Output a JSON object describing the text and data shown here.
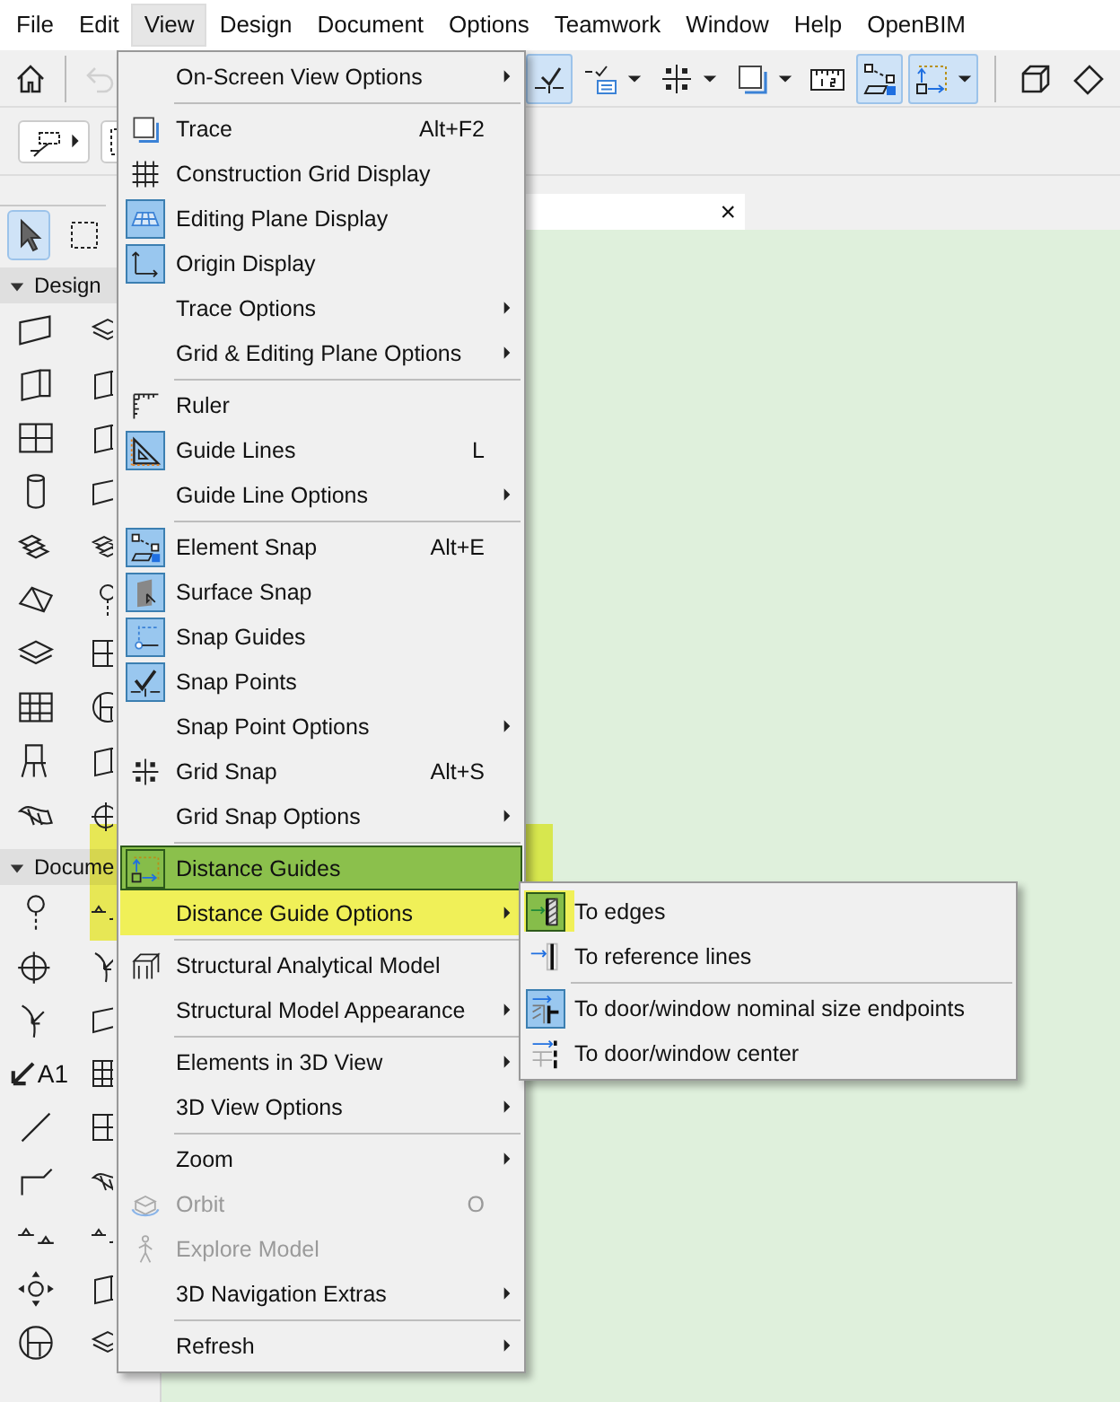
{
  "menubar": [
    {
      "label": "File",
      "open": false
    },
    {
      "label": "Edit",
      "open": false
    },
    {
      "label": "View",
      "open": true
    },
    {
      "label": "Design",
      "open": false
    },
    {
      "label": "Document",
      "open": false
    },
    {
      "label": "Options",
      "open": false
    },
    {
      "label": "Teamwork",
      "open": false
    },
    {
      "label": "Window",
      "open": false
    },
    {
      "label": "Help",
      "open": false
    },
    {
      "label": "OpenBIM",
      "open": false
    }
  ],
  "toolbar": {
    "left_buttons": [
      {
        "on": false,
        "disabled": false
      },
      {
        "on": false,
        "disabled": true
      }
    ],
    "right_buttons": [
      {
        "on": true,
        "dropdown": false
      },
      {
        "on": false,
        "dropdown": true
      },
      {
        "on": false,
        "dropdown": true
      },
      {
        "on": false,
        "dropdown": true
      },
      {
        "on": false,
        "dropdown": false
      },
      {
        "on": true,
        "dropdown": false
      },
      {
        "on": true,
        "dropdown": true
      },
      {
        "on": false,
        "dropdown": false
      },
      {
        "on": false,
        "dropdown": false
      }
    ]
  },
  "tab": {
    "close": "×"
  },
  "toolbox": {
    "tools": [
      {
        "selected": true
      },
      {
        "selected": false
      }
    ],
    "sections": [
      {
        "title": "Design",
        "expanded": true
      },
      {
        "title": "Docume",
        "expanded": true
      }
    ],
    "label_tool_text": "A1"
  },
  "view_menu": {
    "items": [
      {
        "kind": "item",
        "label": "On-Screen View Options",
        "submenu": true,
        "disabled": false,
        "highlighted": false
      },
      {
        "kind": "separator"
      },
      {
        "kind": "item",
        "label": "Trace",
        "shortcut": "Alt+F2",
        "checked": false,
        "submenu": false,
        "disabled": false,
        "highlighted": false
      },
      {
        "kind": "item",
        "label": "Construction Grid Display",
        "checked": false,
        "submenu": false,
        "disabled": false,
        "highlighted": false
      },
      {
        "kind": "item",
        "label": "Editing Plane Display",
        "checked": true,
        "submenu": false,
        "disabled": false,
        "highlighted": false
      },
      {
        "kind": "item",
        "label": "Origin Display",
        "checked": true,
        "submenu": false,
        "disabled": false,
        "highlighted": false
      },
      {
        "kind": "item",
        "label": "Trace Options",
        "submenu": true,
        "disabled": false,
        "highlighted": false
      },
      {
        "kind": "item",
        "label": "Grid & Editing Plane Options",
        "submenu": true,
        "disabled": false,
        "highlighted": false
      },
      {
        "kind": "separator"
      },
      {
        "kind": "item",
        "label": "Ruler",
        "checked": false,
        "submenu": false,
        "disabled": false,
        "highlighted": false
      },
      {
        "kind": "item",
        "label": "Guide Lines",
        "shortcut": "L",
        "checked": true,
        "submenu": false,
        "disabled": false,
        "highlighted": false
      },
      {
        "kind": "item",
        "label": "Guide Line Options",
        "submenu": true,
        "disabled": false,
        "highlighted": false
      },
      {
        "kind": "separator"
      },
      {
        "kind": "item",
        "label": "Element Snap",
        "shortcut": "Alt+E",
        "checked": true,
        "submenu": false,
        "disabled": false,
        "highlighted": false
      },
      {
        "kind": "item",
        "label": "Surface Snap",
        "checked": true,
        "submenu": false,
        "disabled": false,
        "highlighted": false
      },
      {
        "kind": "item",
        "label": "Snap Guides",
        "checked": true,
        "submenu": false,
        "disabled": false,
        "highlighted": false
      },
      {
        "kind": "item",
        "label": "Snap Points",
        "checked": true,
        "submenu": false,
        "disabled": false,
        "highlighted": false
      },
      {
        "kind": "item",
        "label": "Snap Point Options",
        "submenu": true,
        "disabled": false,
        "highlighted": false
      },
      {
        "kind": "item",
        "label": "Grid Snap",
        "shortcut": "Alt+S",
        "checked": false,
        "submenu": false,
        "disabled": false,
        "highlighted": false
      },
      {
        "kind": "item",
        "label": "Grid Snap Options",
        "submenu": true,
        "disabled": false,
        "highlighted": false
      },
      {
        "kind": "separator"
      },
      {
        "kind": "item",
        "label": "Distance Guides",
        "checked": true,
        "submenu": false,
        "disabled": false,
        "highlighted": true,
        "marked": true
      },
      {
        "kind": "item",
        "label": "Distance Guide Options",
        "submenu": true,
        "disabled": false,
        "highlighted": false,
        "marked": true
      },
      {
        "kind": "separator"
      },
      {
        "kind": "item",
        "label": "Structural Analytical Model",
        "checked": false,
        "submenu": false,
        "disabled": false,
        "highlighted": false
      },
      {
        "kind": "item",
        "label": "Structural Model Appearance",
        "submenu": true,
        "disabled": false,
        "highlighted": false
      },
      {
        "kind": "separator"
      },
      {
        "kind": "item",
        "label": "Elements in 3D View",
        "submenu": true,
        "disabled": false,
        "highlighted": false
      },
      {
        "kind": "item",
        "label": "3D View Options",
        "submenu": true,
        "disabled": false,
        "highlighted": false
      },
      {
        "kind": "separator"
      },
      {
        "kind": "item",
        "label": "Zoom",
        "submenu": true,
        "disabled": false,
        "highlighted": false
      },
      {
        "kind": "item",
        "label": "Orbit",
        "shortcut": "O",
        "checked": false,
        "submenu": false,
        "disabled": true,
        "highlighted": false
      },
      {
        "kind": "item",
        "label": "Explore Model",
        "checked": false,
        "submenu": false,
        "disabled": true,
        "highlighted": false
      },
      {
        "kind": "item",
        "label": "3D Navigation Extras",
        "submenu": true,
        "disabled": false,
        "highlighted": false
      },
      {
        "kind": "separator"
      },
      {
        "kind": "item",
        "label": "Refresh",
        "submenu": true,
        "disabled": false,
        "highlighted": false
      }
    ]
  },
  "submenu": {
    "items": [
      {
        "kind": "item",
        "label": "To edges",
        "checked": true,
        "marked": true
      },
      {
        "kind": "item",
        "label": "To reference lines",
        "checked": false
      },
      {
        "kind": "separator"
      },
      {
        "kind": "item",
        "label": "To door/window nominal size endpoints",
        "checked": true
      },
      {
        "kind": "item",
        "label": "To door/window center",
        "checked": false
      }
    ]
  }
}
